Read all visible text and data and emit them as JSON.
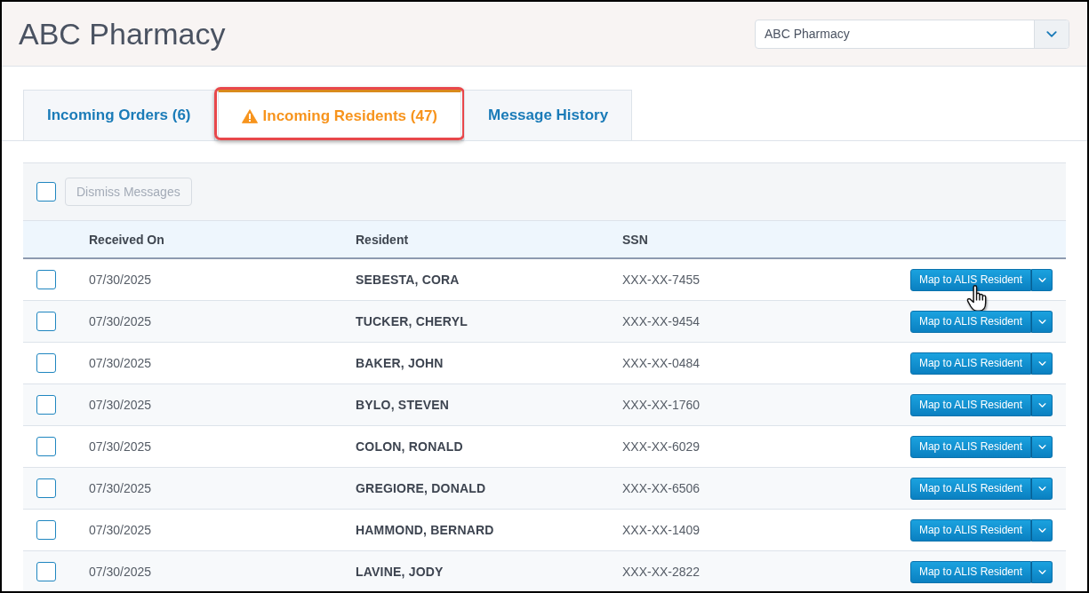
{
  "header": {
    "title": "ABC Pharmacy",
    "pharmacy_select": {
      "value": "ABC Pharmacy"
    }
  },
  "tabs": [
    {
      "label": "Incoming Orders (6)",
      "selected": false,
      "warning": false,
      "highlighted": false
    },
    {
      "label": "Incoming Residents (47)",
      "selected": true,
      "warning": true,
      "highlighted": true
    },
    {
      "label": "Message History",
      "selected": false,
      "warning": false,
      "highlighted": false
    }
  ],
  "toolbar": {
    "select_all": {
      "checked": false
    },
    "dismiss_button": {
      "label": "Dismiss Messages",
      "disabled": true
    }
  },
  "table": {
    "columns": [
      "Received On",
      "Resident",
      "SSN"
    ],
    "rows": [
      {
        "checked": false,
        "received_on": "07/30/2025",
        "resident": "SEBESTA, CORA",
        "ssn": "XXX-XX-7455",
        "action": "Map to ALIS Resident",
        "hovered": true
      },
      {
        "checked": false,
        "received_on": "07/30/2025",
        "resident": "TUCKER, CHERYL",
        "ssn": "XXX-XX-9454",
        "action": "Map to ALIS Resident",
        "hovered": false
      },
      {
        "checked": false,
        "received_on": "07/30/2025",
        "resident": "BAKER, JOHN",
        "ssn": "XXX-XX-0484",
        "action": "Map to ALIS Resident",
        "hovered": false
      },
      {
        "checked": false,
        "received_on": "07/30/2025",
        "resident": "BYLO, STEVEN",
        "ssn": "XXX-XX-1760",
        "action": "Map to ALIS Resident",
        "hovered": false
      },
      {
        "checked": false,
        "received_on": "07/30/2025",
        "resident": "COLON, RONALD",
        "ssn": "XXX-XX-6029",
        "action": "Map to ALIS Resident",
        "hovered": false
      },
      {
        "checked": false,
        "received_on": "07/30/2025",
        "resident": "GREGIORE, DONALD",
        "ssn": "XXX-XX-6506",
        "action": "Map to ALIS Resident",
        "hovered": false
      },
      {
        "checked": false,
        "received_on": "07/30/2025",
        "resident": "HAMMOND, BERNARD",
        "ssn": "XXX-XX-1409",
        "action": "Map to ALIS Resident",
        "hovered": false
      },
      {
        "checked": false,
        "received_on": "07/30/2025",
        "resident": "LAVINE, JODY",
        "ssn": "XXX-XX-2822",
        "action": "Map to ALIS Resident",
        "hovered": false
      }
    ]
  }
}
